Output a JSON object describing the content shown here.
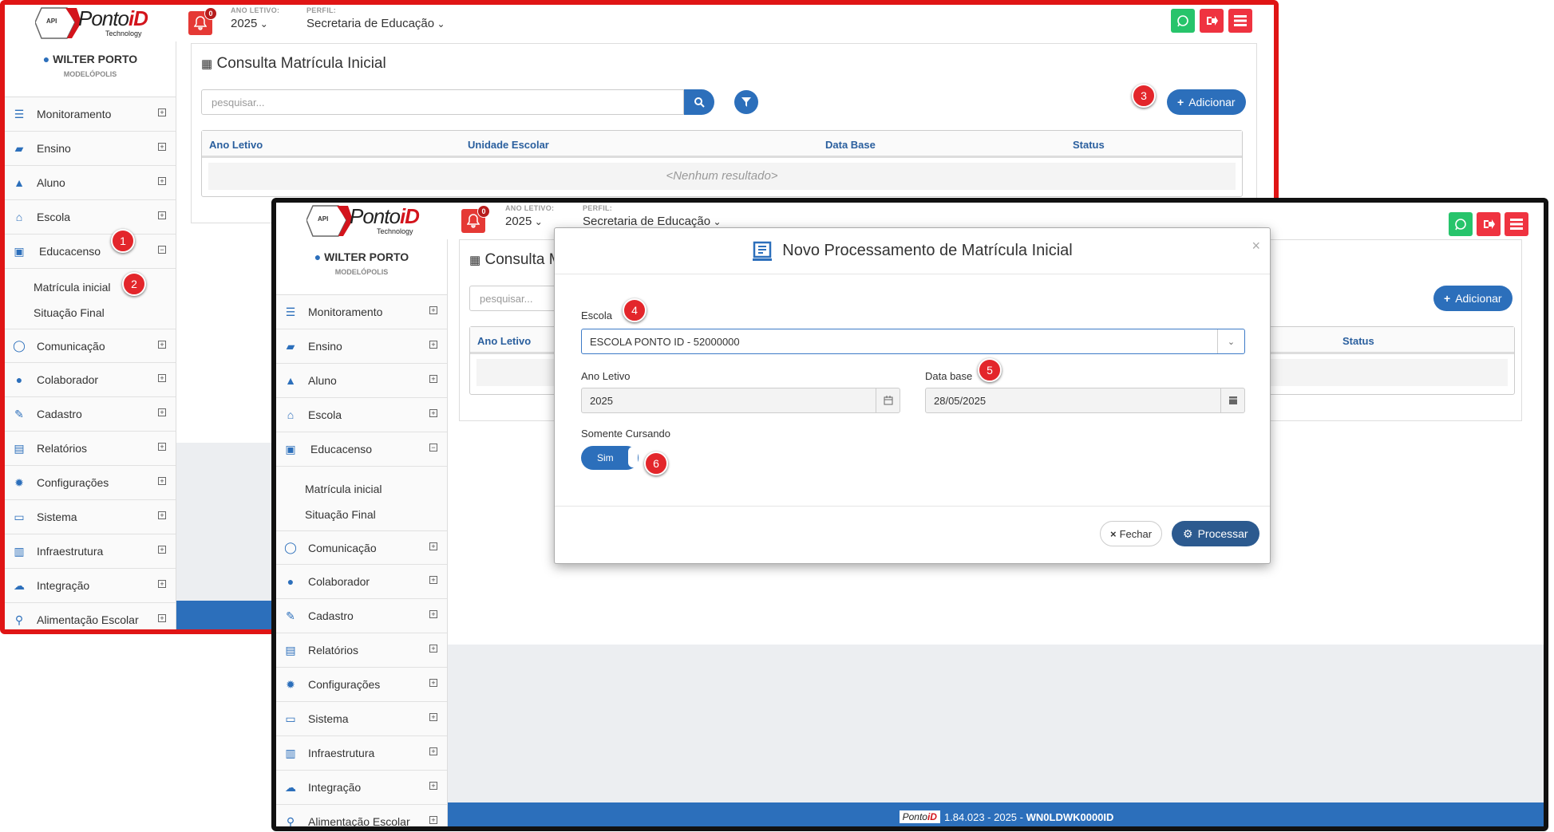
{
  "app": {
    "logo_word": "Ponto",
    "logo_accent": "iD",
    "logo_sub": "Technology",
    "logo_badge": "API",
    "notifications": "0",
    "ano_label": "ANO LETIVO:",
    "ano_value": "2025",
    "perfil_label": "PERFIL:",
    "perfil_value": "Secretaria de Educação",
    "perfil_value_obscured": "Secretaria de Educação",
    "user_name": "WILTER PORTO",
    "user_city": "MODELÓPOLIS"
  },
  "menu": [
    {
      "label": "Monitoramento",
      "icon": "sliders-icon"
    },
    {
      "label": "Ensino",
      "icon": "book-icon"
    },
    {
      "label": "Aluno",
      "icon": "graduation-cap-icon"
    },
    {
      "label": "Escola",
      "icon": "bank-icon"
    },
    {
      "label": "Educacenso",
      "icon": "educacenso-icon"
    },
    {
      "label": "Comunicação",
      "icon": "chat-icon"
    },
    {
      "label": "Colaborador",
      "icon": "user-icon"
    },
    {
      "label": "Cadastro",
      "icon": "edit-icon"
    },
    {
      "label": "Relatórios",
      "icon": "document-icon"
    },
    {
      "label": "Configurações",
      "icon": "gear-icon"
    },
    {
      "label": "Sistema",
      "icon": "monitor-icon"
    },
    {
      "label": "Infraestrutura",
      "icon": "building-icon"
    },
    {
      "label": "Integração",
      "icon": "cloud-icon"
    },
    {
      "label": "Alimentação Escolar",
      "icon": "cutlery-icon"
    }
  ],
  "submenu": {
    "item1": "Matrícula inicial",
    "item2": "Situação Final"
  },
  "page": {
    "title": "Consulta Matrícula Inicial",
    "title_partial": "Consulta M",
    "search_placeholder": "pesquisar...",
    "add_label": "Adicionar",
    "columns": [
      "Ano Letivo",
      "Unidade Escolar",
      "Data Base",
      "Status"
    ],
    "empty": "<Nenhum resultado>"
  },
  "modal": {
    "title": "Novo Processamento de Matrícula Inicial",
    "close_x": "×",
    "escola_label": "Escola",
    "escola_value": "ESCOLA PONTO ID - 52000000",
    "ano_label": "Ano Letivo",
    "ano_value": "2025",
    "database_label": "Data base",
    "database_value": "28/05/2025",
    "somente_label": "Somente Cursando",
    "toggle_label": "Sim",
    "fechar_label": "Fechar",
    "processar_label": "Processar"
  },
  "footer": {
    "version": "1.84.023 - 2025 - ",
    "code": "WN0LDWK0000ID"
  },
  "steps": [
    "1",
    "2",
    "3",
    "4",
    "5",
    "6"
  ],
  "colors": {
    "primary": "#2c6fbb",
    "danger": "#ef3340",
    "whatsapp": "#27c46b",
    "outline1": "#e01515",
    "outline2": "#111111"
  }
}
